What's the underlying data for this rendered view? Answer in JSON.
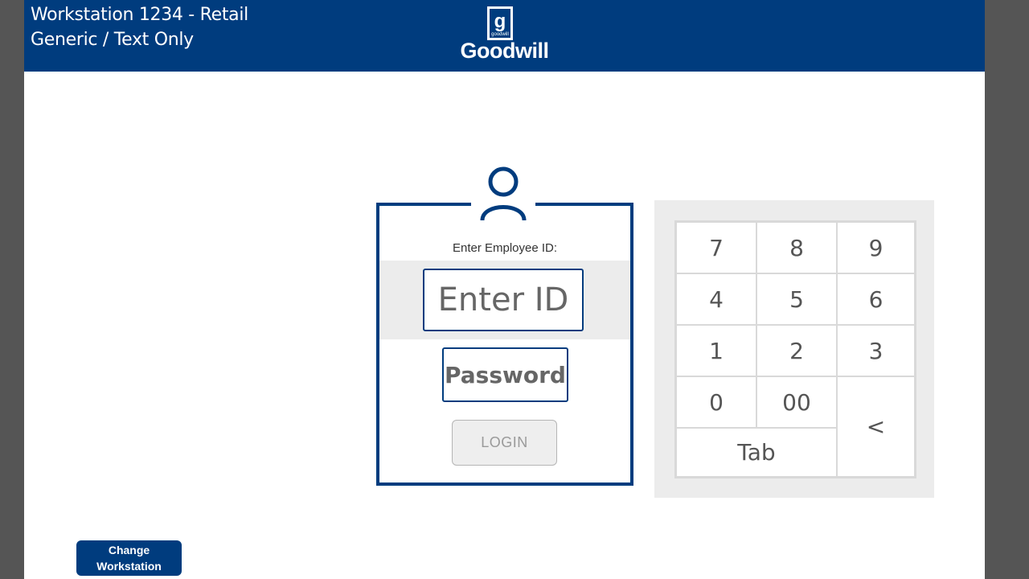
{
  "header": {
    "workstation_title": "Workstation 1234 - Retail",
    "workstation_subtitle": "Generic / Text Only",
    "logo_text": "Goodwill",
    "logo_mark_text": "goodwill"
  },
  "login": {
    "employee_label": "Enter Employee ID:",
    "id_placeholder": "Enter ID",
    "password_placeholder": "Password",
    "login_label": "LOGIN"
  },
  "keypad": {
    "keys": {
      "k7": "7",
      "k8": "8",
      "k9": "9",
      "k4": "4",
      "k5": "5",
      "k6": "6",
      "k1": "1",
      "k2": "2",
      "k3": "3",
      "k0": "0",
      "k00": "00",
      "back": "<",
      "tab": "Tab"
    }
  },
  "footer": {
    "change_line1": "Change",
    "change_line2": "Workstation"
  },
  "colors": {
    "brand_blue": "#003c7e",
    "panel_gray": "#ececec",
    "frame_gray": "#555555"
  },
  "icons": [
    "goodwill-logo-icon",
    "user-icon"
  ]
}
